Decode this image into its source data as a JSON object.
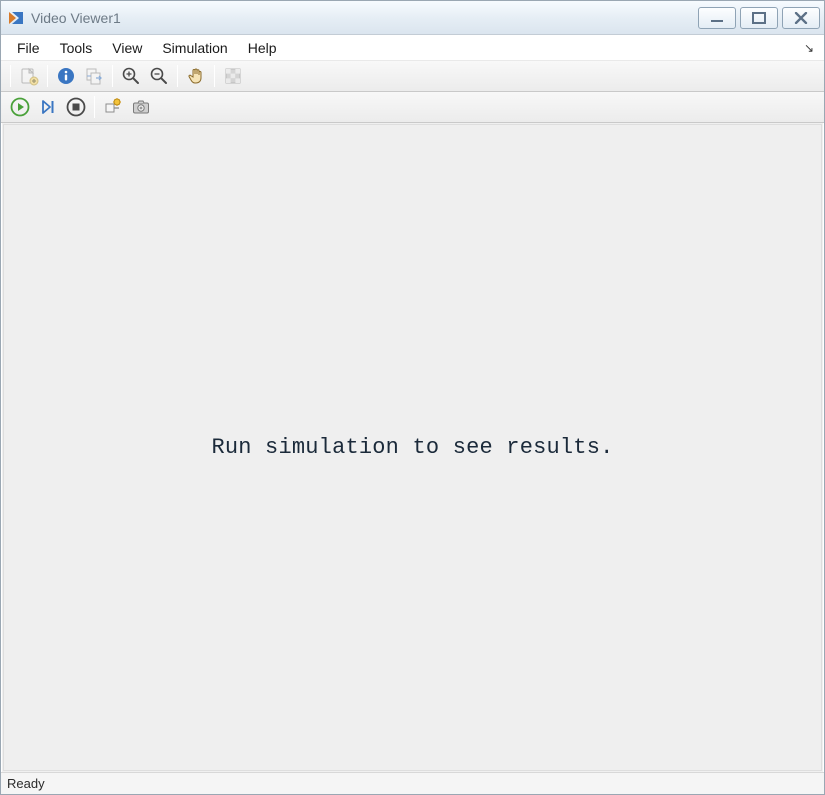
{
  "titlebar": {
    "title": "Video Viewer1"
  },
  "menubar": {
    "items": [
      "File",
      "Tools",
      "View",
      "Simulation",
      "Help"
    ]
  },
  "toolbar1": {
    "new_video": "new-video-icon",
    "info": "info-icon",
    "export": "export-icon",
    "zoom_in": "zoom-in-icon",
    "zoom_out": "zoom-out-icon",
    "pan": "pan-icon",
    "pixel_region": "pixel-region-icon"
  },
  "toolbar2": {
    "run": "play-icon",
    "step": "step-forward-icon",
    "stop": "stop-icon",
    "highlight_block": "highlight-block-icon",
    "snapshot": "snapshot-icon"
  },
  "content": {
    "message": "Run simulation to see results."
  },
  "statusbar": {
    "text": "Ready"
  },
  "colors": {
    "accent_blue": "#3a76c2",
    "accent_green": "#4aa13a"
  }
}
